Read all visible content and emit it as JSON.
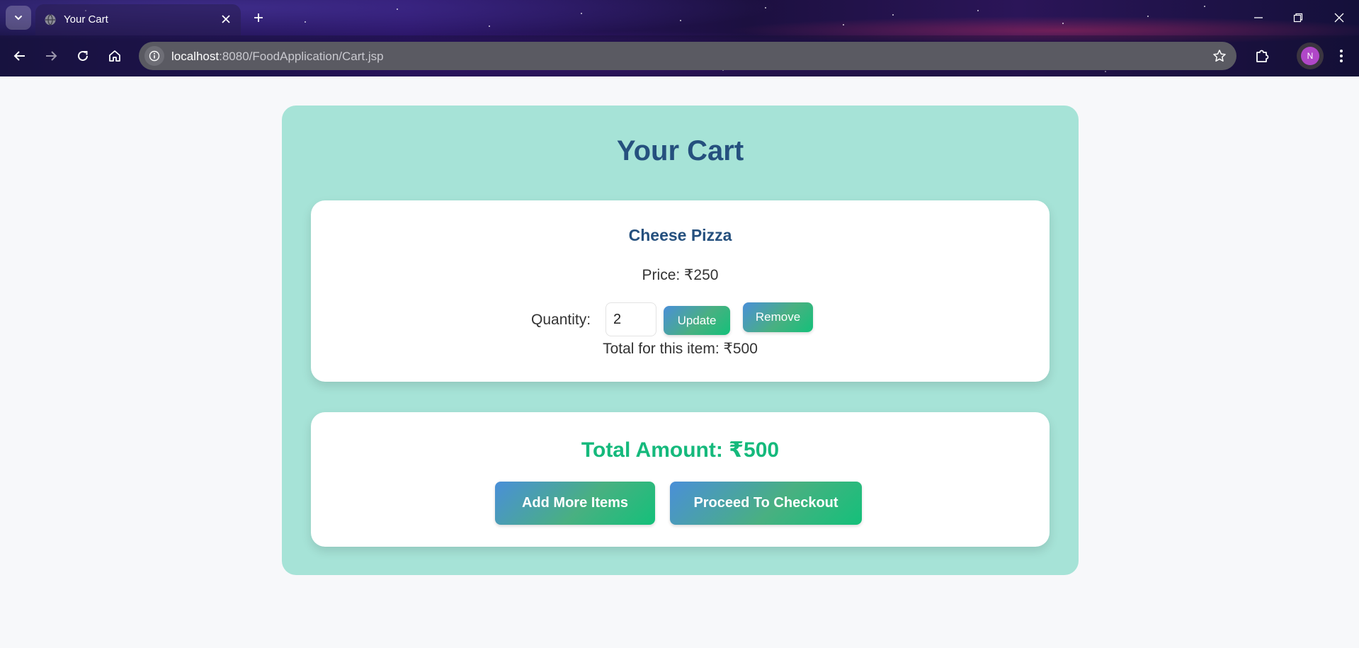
{
  "browser": {
    "tab": {
      "title": "Your Cart",
      "favicon": "globe-icon"
    },
    "url": {
      "host": "localhost",
      "path": ":8080/FoodApplication/Cart.jsp"
    },
    "profile_initial": "N",
    "icons": {
      "tab_list": "chevron-down-icon",
      "close_tab": "close-icon",
      "new_tab": "plus-icon",
      "minimize": "minimize-icon",
      "restore": "restore-icon",
      "close_window": "close-icon",
      "back": "back-arrow-icon",
      "forward": "forward-arrow-icon",
      "reload": "reload-icon",
      "home": "home-icon",
      "site_info": "info-icon",
      "bookmark": "star-icon",
      "extensions": "puzzle-icon",
      "menu": "kebab-menu-icon"
    }
  },
  "cart": {
    "title": "Your Cart",
    "items": [
      {
        "name": "Cheese Pizza",
        "price_text": "Price: ₹250",
        "quantity_label": "Quantity:",
        "quantity_value": "2",
        "update_label": "Update",
        "remove_label": "Remove",
        "total_text": "Total for this item: ₹500"
      }
    ],
    "summary": {
      "total_text": "Total Amount: ₹500",
      "add_more_label": "Add More Items",
      "checkout_label": "Proceed To Checkout"
    }
  },
  "colors": {
    "container_bg": "#a6e3d7",
    "title": "#25507e",
    "total_amount": "#15b97c",
    "button_gradient_start": "#4a8fd8",
    "button_gradient_end": "#14c07a",
    "avatar": "#b047c8"
  }
}
